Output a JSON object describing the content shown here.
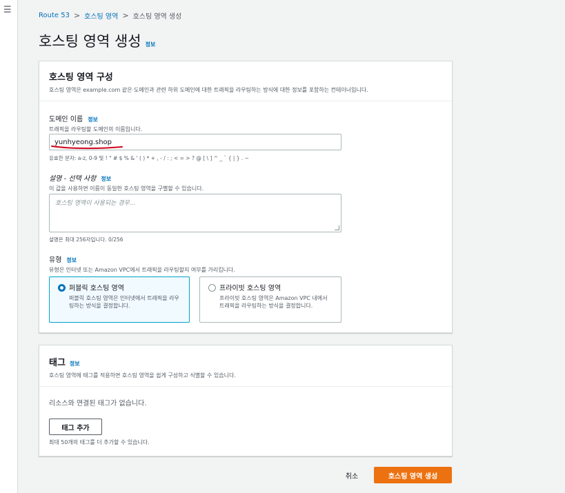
{
  "nav": {
    "menu_icon": "hamburger-icon"
  },
  "breadcrumb": {
    "items": [
      "Route 53",
      "호스팅 영역"
    ],
    "current": "호스팅 영역 생성",
    "separator": ">"
  },
  "page": {
    "title": "호스팅 영역 생성",
    "info": "정보"
  },
  "config": {
    "heading": "호스팅 영역 구성",
    "description": "호스팅 영역은 example.com 같은 도메인과 관련 하위 도메인에 대한 트래픽을 라우팅하는 방식에 대한 정보를 포함하는 컨테이너입니다.",
    "domain": {
      "label": "도메인 이름",
      "info": "정보",
      "description": "트래픽을 라우팅할 도메인의 이름입니다.",
      "value": "yunhyeong.shop",
      "constraint": "유효한 문자: a-z, 0-9 및 ! \" # $ % & ' ( ) * + , - / : ; < = > ? @ [ \\ ] ^ _ ` { | } . ~"
    },
    "desc_field": {
      "label": "설명 - 선택 사항",
      "info": "정보",
      "description": "이 값을 사용하면 이름이 동일한 호스팅 영역을 구별할 수 있습니다.",
      "placeholder": "호스팅 영역이 사용되는 경우...",
      "constraint": "설명은 최대 256자입니다. 0/256"
    },
    "type": {
      "label": "유형",
      "info": "정보",
      "description": "유형은 인터넷 또는 Amazon VPC에서 트래픽을 라우팅할지 여부를 가리킵니다.",
      "options": [
        {
          "title": "퍼블릭 호스팅 영역",
          "desc": "퍼블릭 호스팅 영역은 인터넷에서 트래픽을 라우팅하는 방식을 결정합니다.",
          "selected": true
        },
        {
          "title": "프라이빗 호스팅 영역",
          "desc": "프라이빗 호스팅 영역은 Amazon VPC 내에서 트래픽을 라우팅하는 방식을 결정합니다.",
          "selected": false
        }
      ]
    }
  },
  "tags": {
    "heading": "태그",
    "info": "정보",
    "description": "호스팅 영역에 태그를 적용하면 호스팅 영역을 쉽게 구성하고 식별할 수 있습니다.",
    "empty": "리소스와 연결된 태그가 없습니다.",
    "add_button": "태그 추가",
    "limit": "최대 50개의 태그를 더 추가할 수 있습니다."
  },
  "footer": {
    "cancel": "취소",
    "submit": "호스팅 영역 생성"
  },
  "colors": {
    "primary": "#ec7211",
    "link": "#0073bb",
    "annotation": "#d0021b"
  }
}
